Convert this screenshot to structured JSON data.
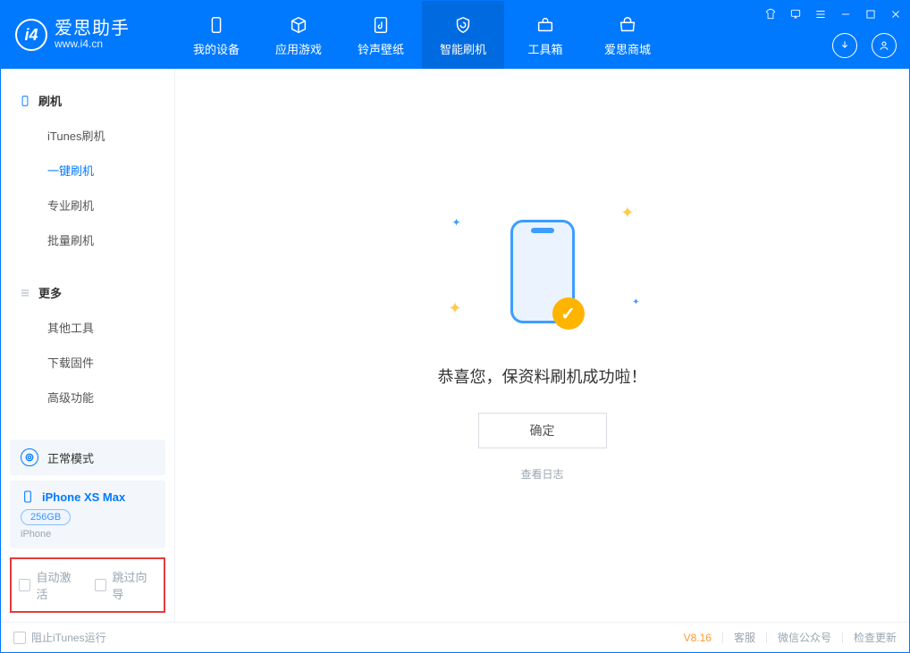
{
  "brand": {
    "cn": "爱思助手",
    "en": "www.i4.cn"
  },
  "nav": {
    "items": [
      {
        "label": "我的设备"
      },
      {
        "label": "应用游戏"
      },
      {
        "label": "铃声壁纸"
      },
      {
        "label": "智能刷机"
      },
      {
        "label": "工具箱"
      },
      {
        "label": "爱思商城"
      }
    ]
  },
  "sidebar": {
    "group1_title": "刷机",
    "group1_items": [
      "iTunes刷机",
      "一键刷机",
      "专业刷机",
      "批量刷机"
    ],
    "group2_title": "更多",
    "group2_items": [
      "其他工具",
      "下载固件",
      "高级功能"
    ]
  },
  "devices": {
    "mode_label": "正常模式",
    "name": "iPhone XS Max",
    "capacity": "256GB",
    "subtype": "iPhone"
  },
  "options": {
    "auto_activate": "自动激活",
    "skip_guide": "跳过向导"
  },
  "main": {
    "success_text": "恭喜您，保资料刷机成功啦！",
    "confirm_label": "确定",
    "log_link": "查看日志"
  },
  "status": {
    "stop_itunes": "阻止iTunes运行",
    "version": "V8.16",
    "links": [
      "客服",
      "微信公众号",
      "检查更新"
    ]
  }
}
